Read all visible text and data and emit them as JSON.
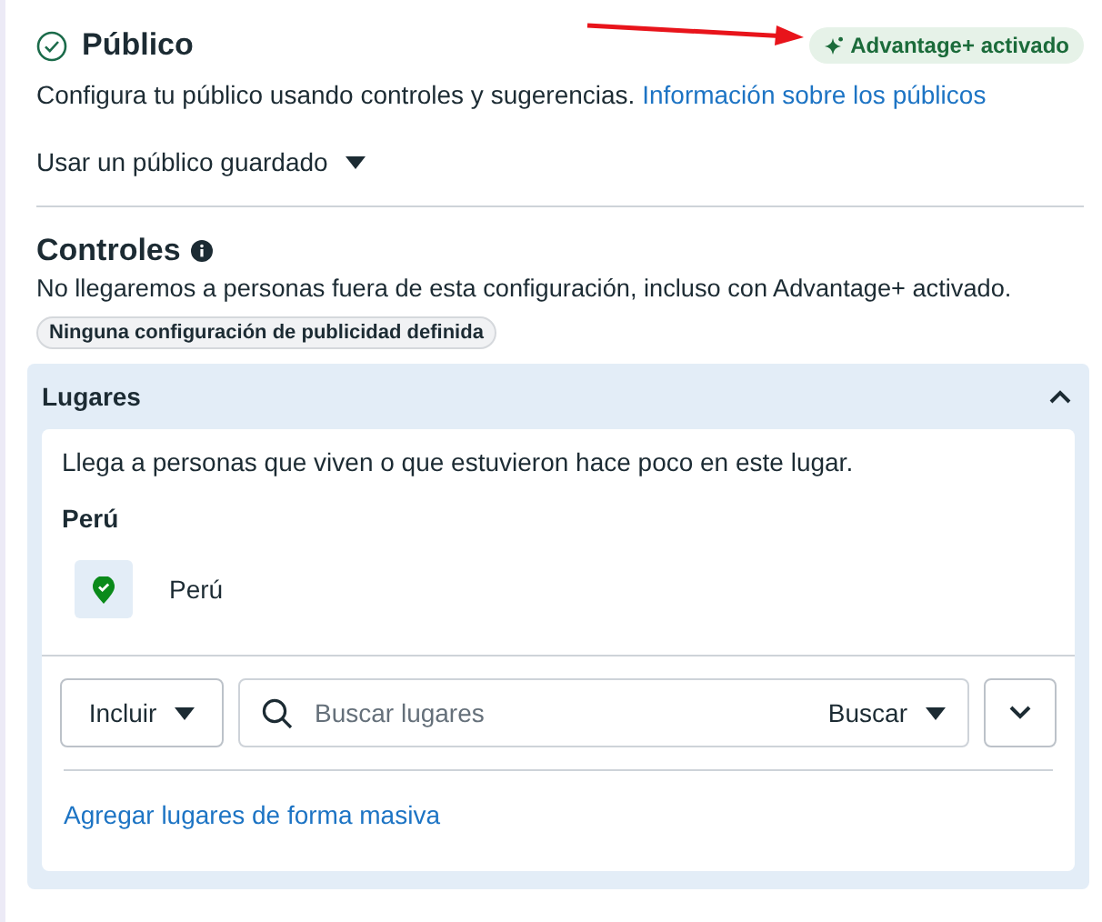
{
  "header": {
    "title": "Público",
    "badge": "Advantage+ activado"
  },
  "intro": {
    "text": "Configura tu público usando controles y sugerencias.",
    "link": "Información sobre los públicos"
  },
  "saved_audience": {
    "label": "Usar un público guardado"
  },
  "controls": {
    "title": "Controles",
    "description": "No llegaremos a personas fuera de esta configuración, incluso con Advantage+ activado.",
    "tag": "Ninguna configuración de publicidad definida"
  },
  "places": {
    "title": "Lugares",
    "expanded": true,
    "description": "Llega a personas que viven o que estuvieron hace poco en este lugar.",
    "group_title": "Perú",
    "items": [
      {
        "name": "Perú"
      }
    ],
    "include_dropdown": "Incluir",
    "search": {
      "placeholder": "Buscar lugares",
      "type_dropdown": "Buscar"
    },
    "bulk_link": "Agregar lugares de forma masiva"
  }
}
